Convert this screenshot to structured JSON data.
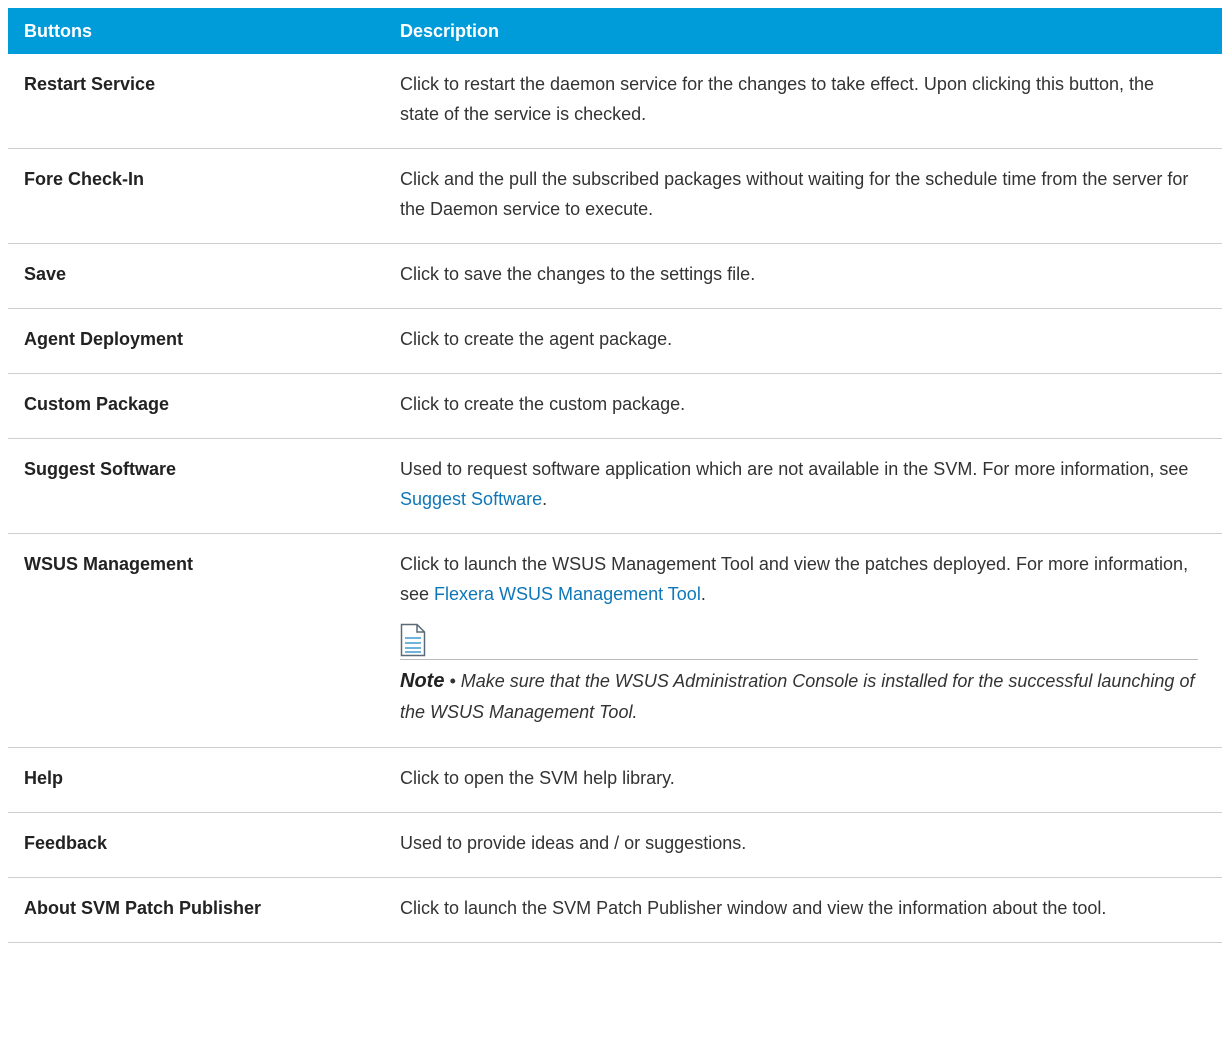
{
  "table": {
    "headers": {
      "buttons": "Buttons",
      "description": "Description"
    },
    "rows": [
      {
        "button": "Restart Service",
        "description": "Click to restart the daemon service for the changes to take effect. Upon clicking this button, the state of the service is checked."
      },
      {
        "button": "Fore Check-In",
        "description": "Click and the pull the subscribed packages without waiting for the schedule time from the server for the Daemon service to execute."
      },
      {
        "button": "Save",
        "description": "Click to save the changes to the settings file."
      },
      {
        "button": "Agent Deployment",
        "description": "Click to create the agent package."
      },
      {
        "button": "Custom Package",
        "description": "Click to create the custom package."
      },
      {
        "button": "Suggest Software",
        "description_before": "Used to request software application which are not available in the SVM. For more information, see ",
        "link": "Suggest Software",
        "description_after": "."
      },
      {
        "button": "WSUS Management",
        "description_before": "Click to launch the WSUS Management Tool and view the patches deployed. For more information, see ",
        "link": "Flexera WSUS Management Tool",
        "description_after": ".",
        "note": {
          "icon": "note-document-icon",
          "label": "Note",
          "separator": " • ",
          "text": "Make sure that the WSUS Administration Console is installed for the successful launching of the WSUS Management Tool."
        }
      },
      {
        "button": "Help",
        "description": "Click to open the SVM help library."
      },
      {
        "button": "Feedback",
        "description": "Used to provide ideas and / or suggestions."
      },
      {
        "button": "About SVM Patch Publisher",
        "description": "Click to launch the SVM Patch Publisher window and view the information about the tool."
      }
    ]
  },
  "colors": {
    "header_background": "#009bd9",
    "header_text": "#ffffff",
    "link": "#0f77b8",
    "row_divider": "#cfcfcf"
  }
}
